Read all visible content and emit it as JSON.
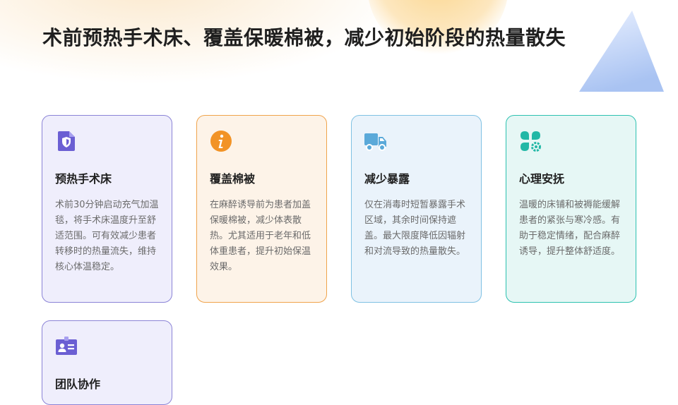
{
  "title": "术前预热手术床、覆盖保暖棉被，减少初始阶段的热量散失",
  "colors": {
    "purple_accent": "#6b5fd3",
    "orange_accent": "#f29326",
    "blue_accent": "#5aa9d9",
    "teal_accent": "#22b8a6"
  },
  "cards": [
    {
      "icon": "shield-document-icon",
      "heading": "预热手术床",
      "text": "术前30分钟启动充气加温毯，将手术床温度升至舒适范围。可有效减少患者转移时的热量流失，维持核心体温稳定。"
    },
    {
      "icon": "info-icon",
      "heading": "覆盖棉被",
      "text": "在麻醉诱导前为患者加盖保暖棉被，减少体表散热。尤其适用于老年和低体重患者，提升初始保温效果。"
    },
    {
      "icon": "truck-icon",
      "heading": "减少暴露",
      "text": "仅在消毒时短暂暴露手术区域，其余时间保持遮盖。最大限度降低因辐射和对流导致的热量散失。"
    },
    {
      "icon": "clover-gear-icon",
      "heading": "心理安抚",
      "text": "温暖的床铺和被褥能缓解患者的紧张与寒冷感。有助于稳定情绪，配合麻醉诱导，提升整体舒适度。"
    },
    {
      "icon": "id-badge-icon",
      "heading": "团队协作",
      "text": ""
    }
  ]
}
